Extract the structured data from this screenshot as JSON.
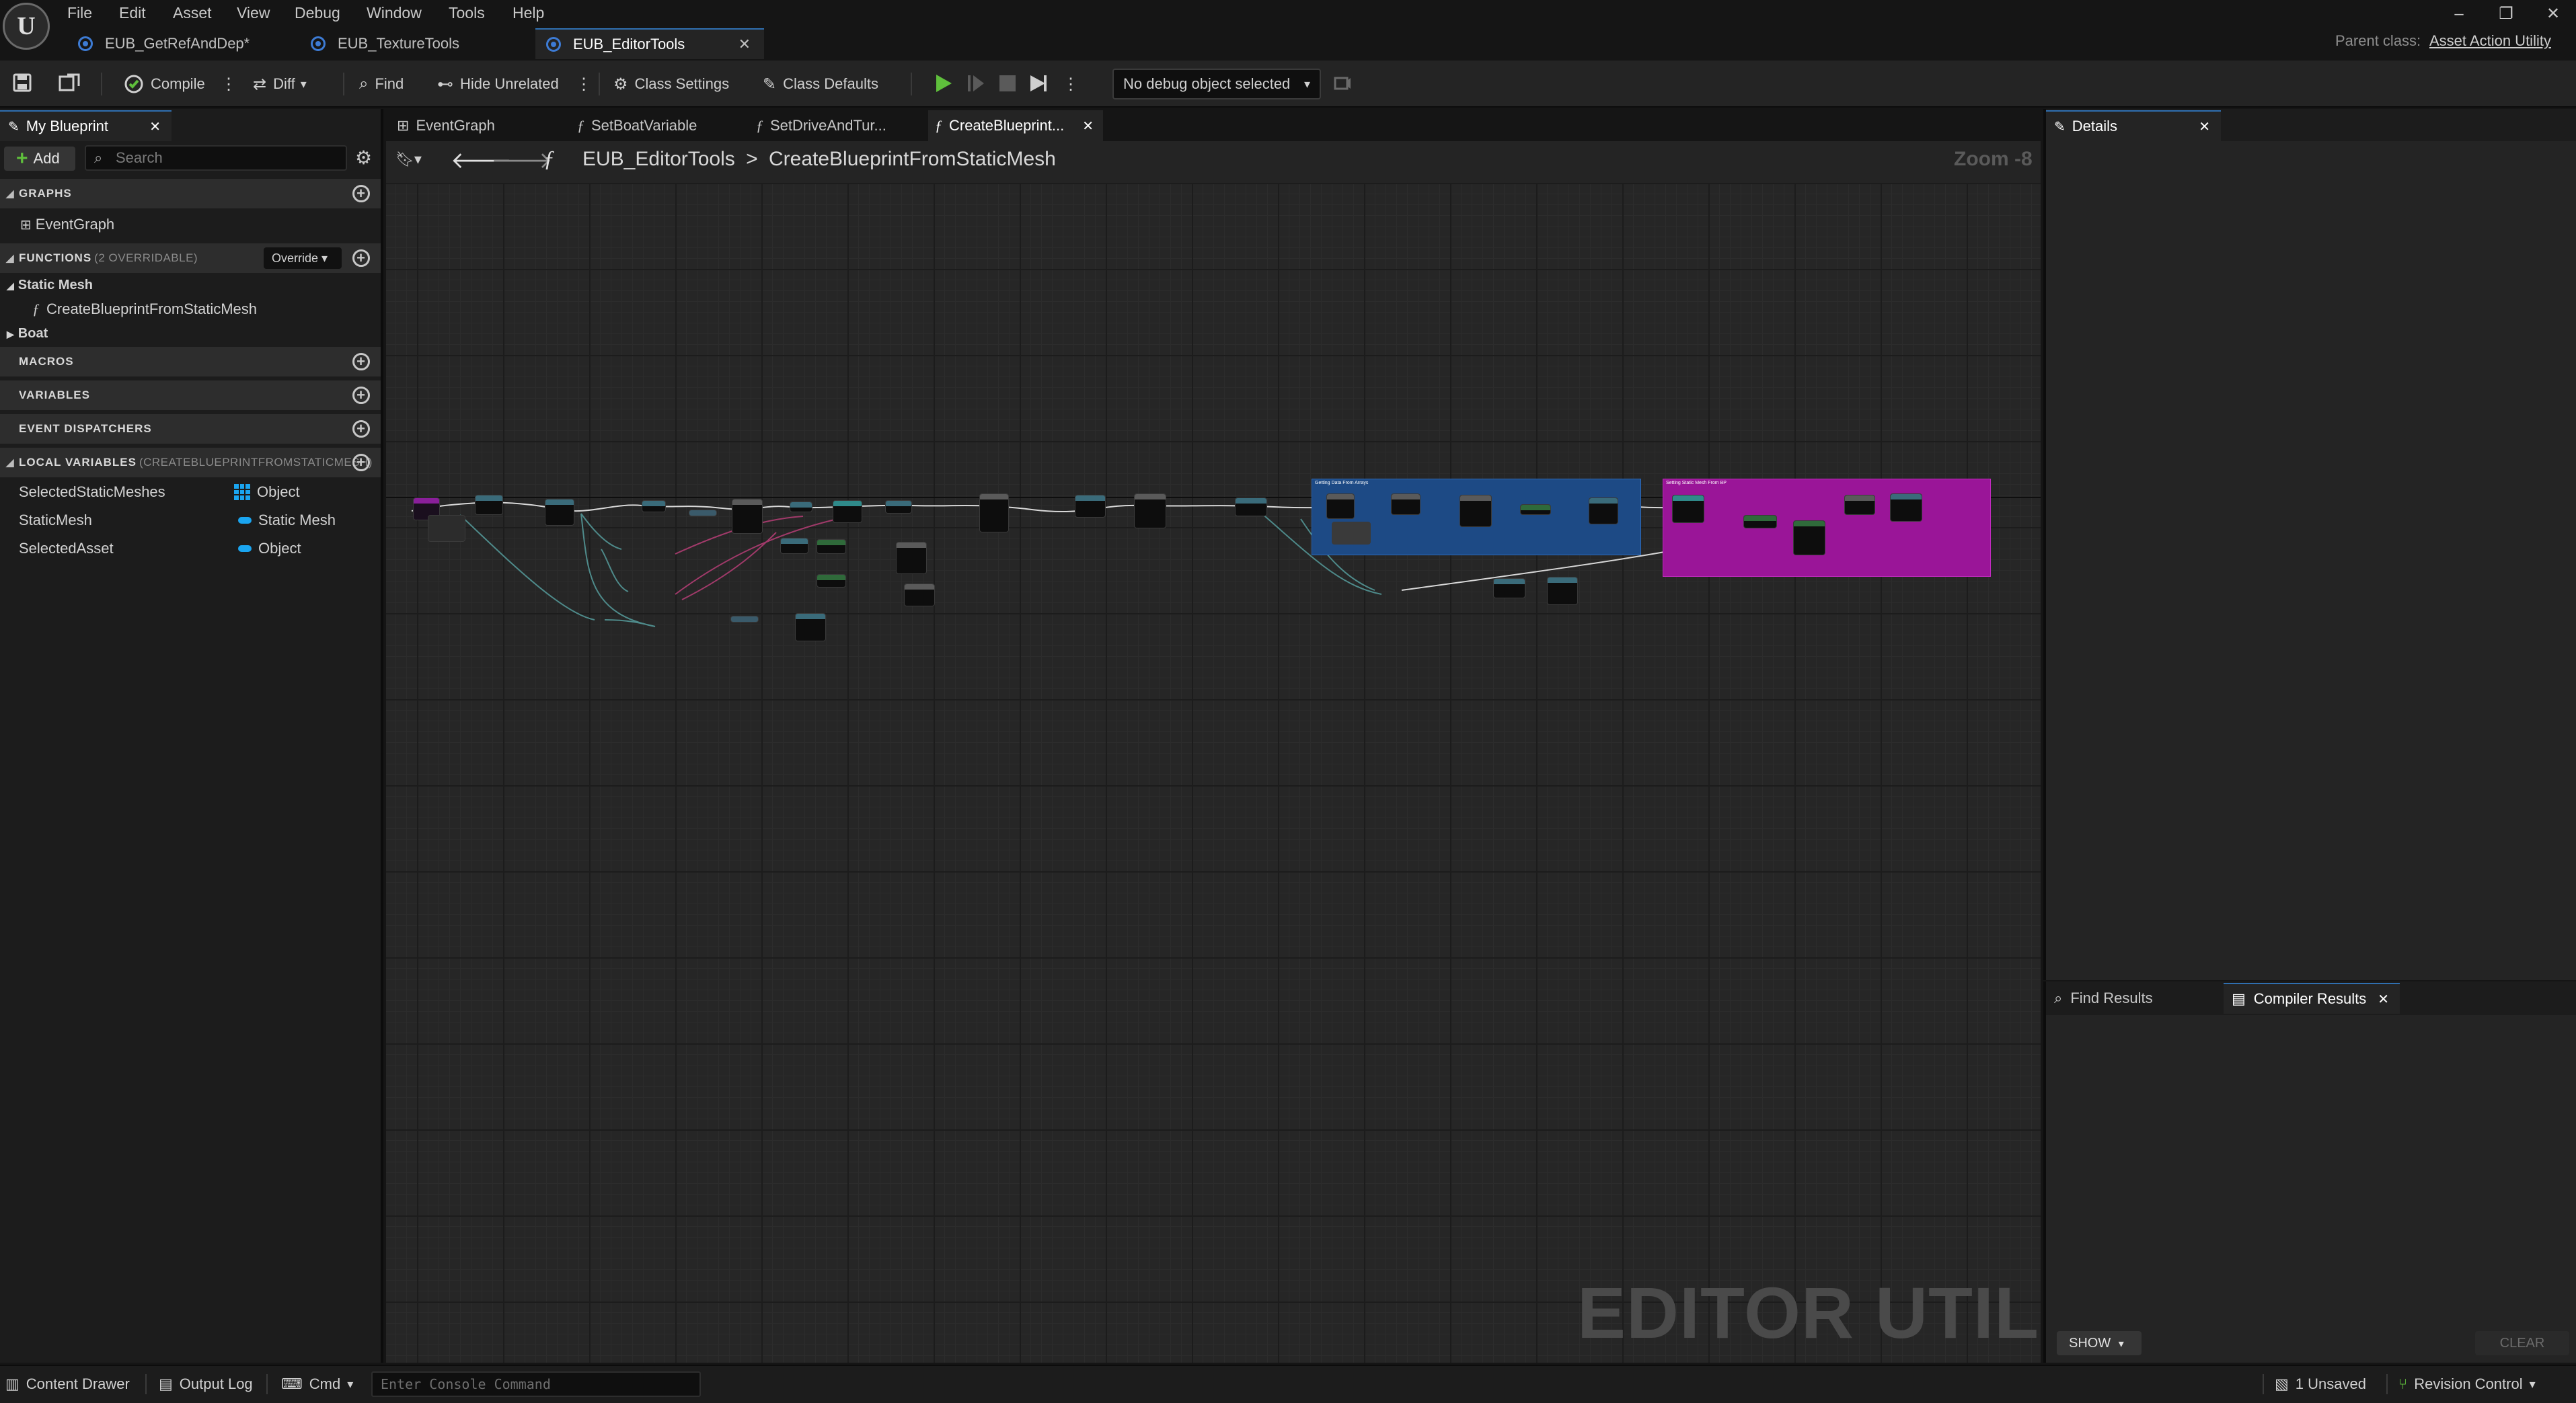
{
  "app": {
    "menu": [
      "File",
      "Edit",
      "Asset",
      "View",
      "Debug",
      "Window",
      "Tools",
      "Help"
    ],
    "doc_tabs": [
      {
        "label": "EUB_GetRefAndDep*"
      },
      {
        "label": "EUB_TextureTools"
      },
      {
        "label": "EUB_EditorTools",
        "active": true
      }
    ],
    "parent_class_label": "Parent class:",
    "parent_class_value": "Asset Action Utility",
    "window_controls": {
      "minimize": "–",
      "restore": "❐",
      "close": "✕"
    }
  },
  "toolbar": {
    "compile": "Compile",
    "diff": "Diff",
    "find": "Find",
    "hide_unrelated": "Hide Unrelated",
    "class_settings": "Class Settings",
    "class_defaults": "Class Defaults",
    "debug_object": "No debug object selected"
  },
  "my_blueprint": {
    "tab": "My Blueprint",
    "add": "Add",
    "search_placeholder": "Search",
    "sections": {
      "graphs": "GRAPHS",
      "functions": "FUNCTIONS",
      "functions_sub": "(2 OVERRIDABLE)",
      "override": "Override",
      "macros": "MACROS",
      "variables": "VARIABLES",
      "event_dispatchers": "EVENT DISPATCHERS",
      "local_variables": "LOCAL VARIABLES",
      "local_variables_sub": "(CREATEBLUEPRINTFROMSTATICMESH)"
    },
    "graphs": [
      "EventGraph"
    ],
    "function_categories": [
      {
        "name": "Static Mesh",
        "items": [
          "CreateBlueprintFromStaticMesh"
        ]
      },
      {
        "name": "Boat",
        "items": []
      }
    ],
    "local_variables": [
      {
        "name": "SelectedStaticMeshes",
        "type": "Object",
        "icon": "array-grid-icon",
        "color": "#1aa5f0"
      },
      {
        "name": "StaticMesh",
        "type": "Static Mesh",
        "icon": "pill-icon",
        "color": "#1aa5f0"
      },
      {
        "name": "SelectedAsset",
        "type": "Object",
        "icon": "pill-icon",
        "color": "#1aa5f0"
      }
    ]
  },
  "graph": {
    "tabs": [
      "EventGraph",
      "SetBoatVariable",
      "SetDriveAndTur...",
      "CreateBlueprint..."
    ],
    "breadcrumb_root": "EUB_EditorTools",
    "breadcrumb_sep": ">",
    "breadcrumb_current": "CreateBlueprintFromStaticMesh",
    "zoom": "Zoom -8",
    "watermark": "EDITOR UTILITY",
    "comments": [
      {
        "title": "Getting Data From Arrays",
        "color": "#1f4f8f"
      },
      {
        "title": "Setting Static Mesh From BP",
        "color": "#a0149e"
      }
    ]
  },
  "details": {
    "tab": "Details"
  },
  "results": {
    "tabs": [
      "Find Results",
      "Compiler Results"
    ],
    "show": "SHOW",
    "clear": "CLEAR"
  },
  "statusbar": {
    "content_drawer": "Content Drawer",
    "output_log": "Output Log",
    "cmd": "Cmd",
    "console_placeholder": "Enter Console Command",
    "unsaved": "1 Unsaved",
    "revision_control": "Revision Control"
  },
  "colors": {
    "accent": "#2f6fb0",
    "play": "#5fbf3c",
    "variable_pin": "#1aa5f0",
    "comment_blue": "#1f4f8f",
    "comment_magenta": "#a0149e"
  }
}
